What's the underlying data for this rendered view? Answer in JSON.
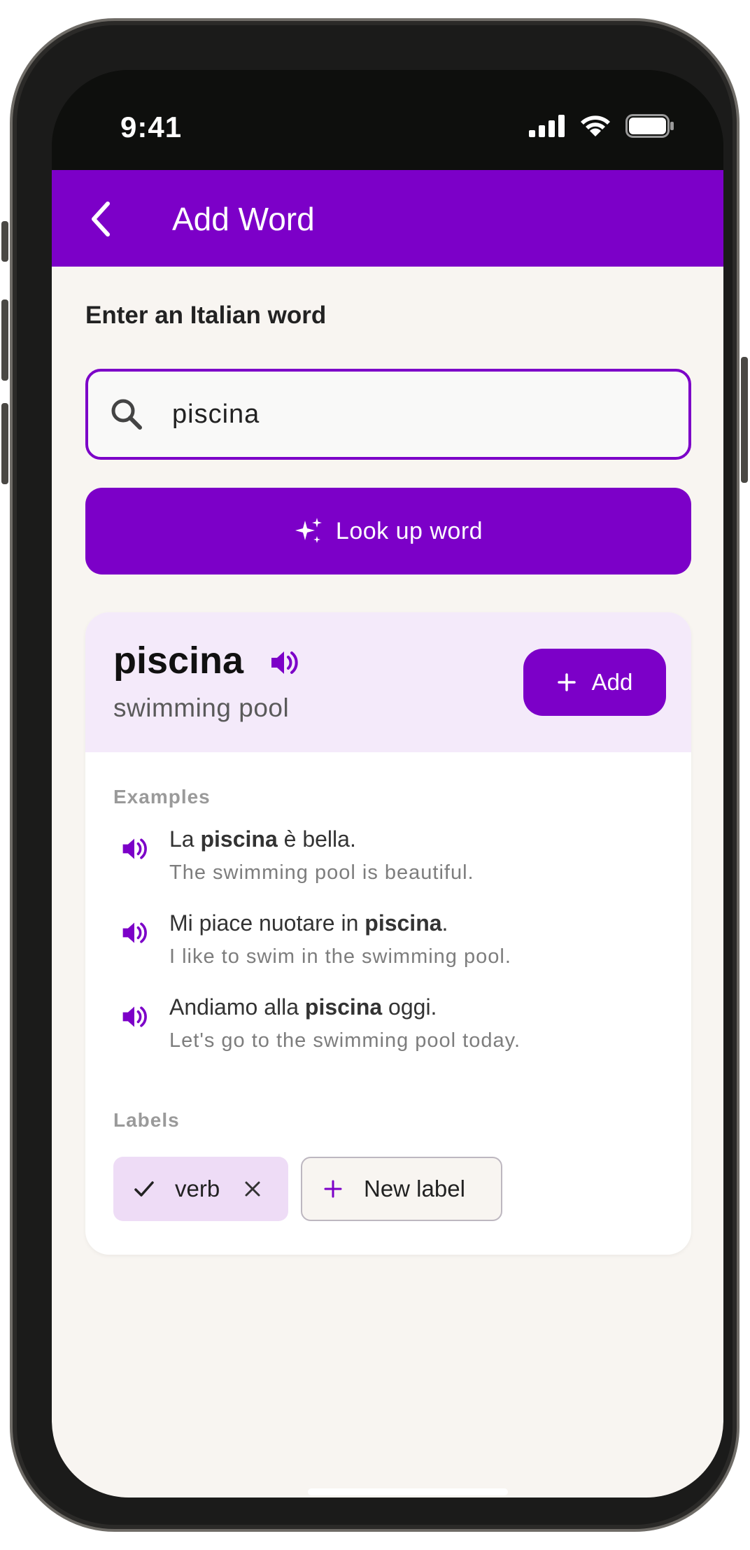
{
  "status_bar": {
    "time": "9:41"
  },
  "app_bar": {
    "title": "Add Word",
    "back_icon": "chevron-left-icon"
  },
  "search": {
    "prompt": "Enter an Italian word",
    "value": "piscina",
    "icon": "search-icon",
    "lookup_label": "Look up word",
    "lookup_icon": "sparkle-icon"
  },
  "result": {
    "word": "piscina",
    "translation": "swimming pool",
    "add_label": "Add",
    "examples_heading": "Examples",
    "examples": [
      {
        "before": "La ",
        "bold": "piscina",
        "after": " è bella.",
        "translation": "The swimming pool is beautiful."
      },
      {
        "before": "Mi piace nuotare in ",
        "bold": "piscina",
        "after": ".",
        "translation": "I like to swim in the swimming pool."
      },
      {
        "before": "Andiamo alla ",
        "bold": "piscina",
        "after": " oggi.",
        "translation": "Let's go to the swimming pool today."
      }
    ],
    "labels_heading": "Labels",
    "labels": [
      {
        "label": "verb",
        "selected": true
      }
    ],
    "new_label": "New label"
  },
  "colors": {
    "accent": "#7c00c8",
    "header_tint": "#f4eafa",
    "chip_selected": "#eedcf6",
    "background": "#f8f5f1"
  }
}
